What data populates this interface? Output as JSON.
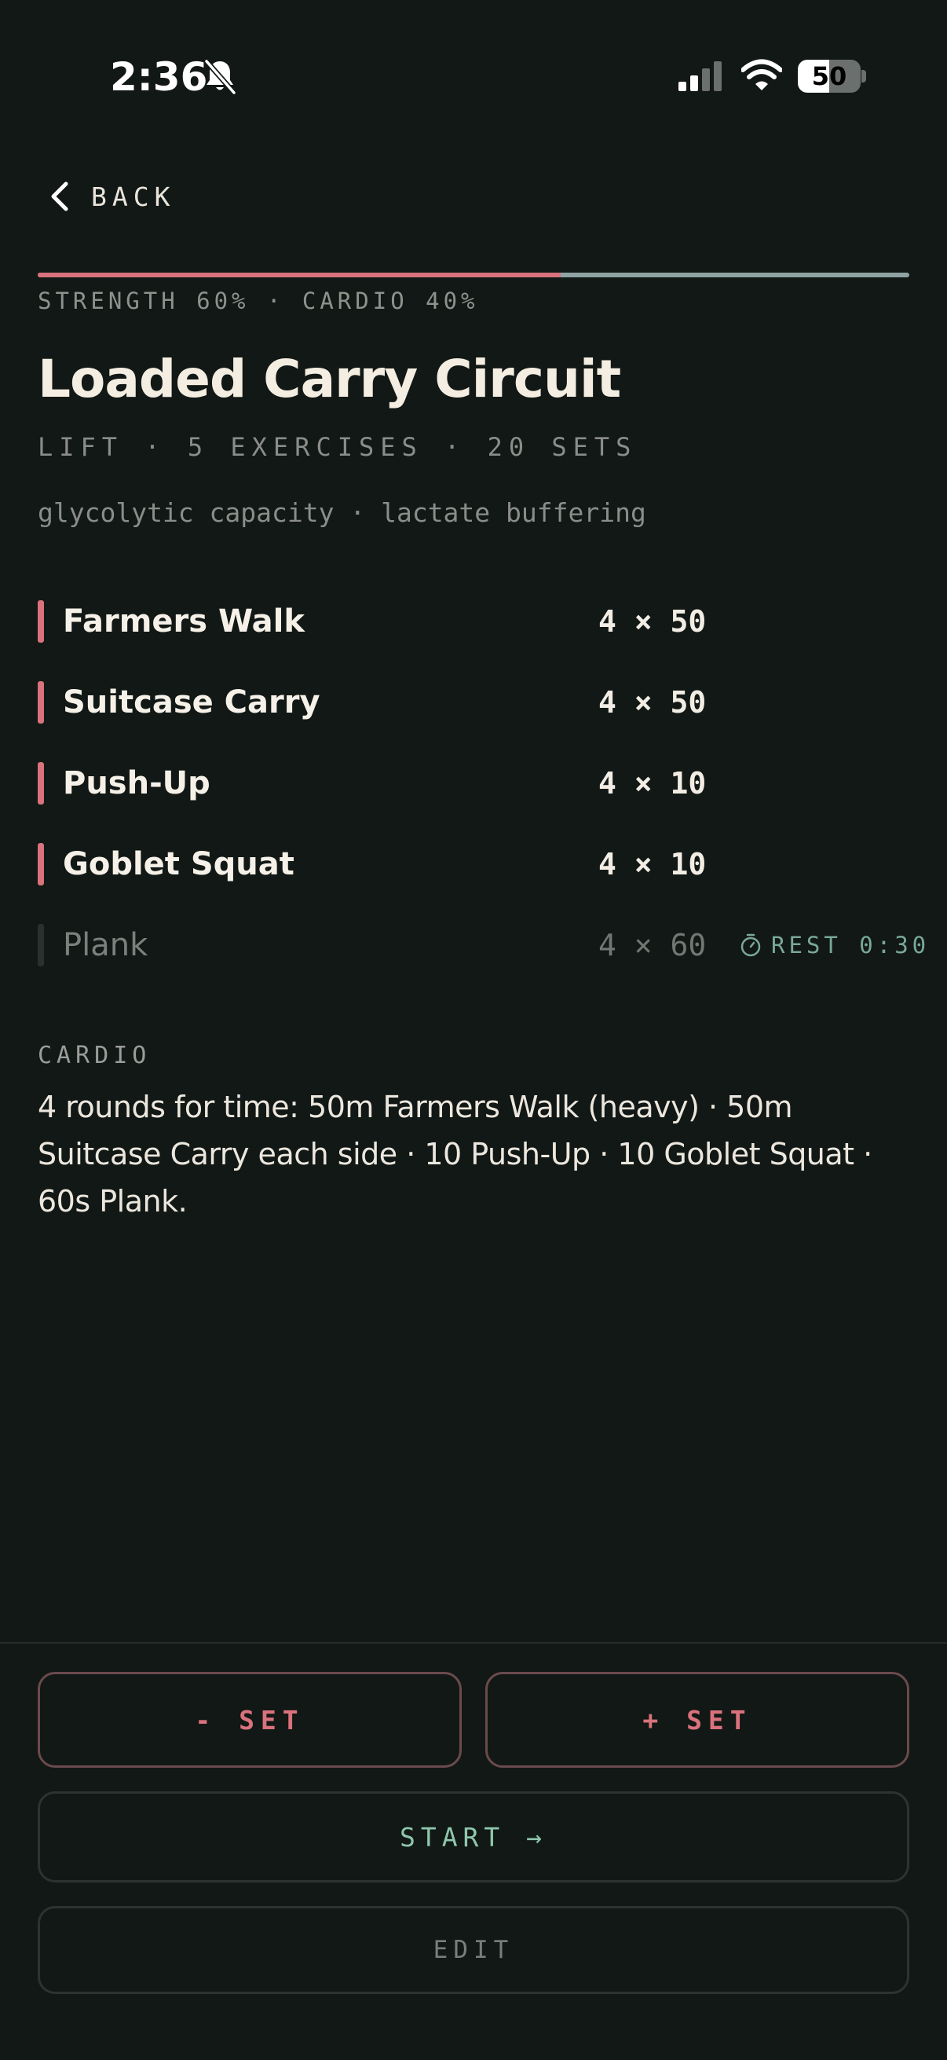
{
  "status_bar": {
    "time": "2:36",
    "battery": "50",
    "battery_level": 0.5,
    "icons": [
      "bell-slash-icon",
      "cellular-signal-icon",
      "wifi-icon",
      "battery-icon"
    ]
  },
  "nav": {
    "back_label": "BACK"
  },
  "split": {
    "label": "STRENGTH 60% · CARDIO 40%",
    "strength_fraction": 0.6,
    "cardio_fraction": 0.4,
    "strength_color": "#d9727c",
    "cardio_color": "#8fa3a3"
  },
  "workout": {
    "title": "Loaded Carry Circuit",
    "meta": "LIFT · 5 EXERCISES · 20 SETS",
    "tags": "glycolytic capacity · lactate buffering"
  },
  "exercises": [
    {
      "name": "Farmers Walk",
      "sets": "4 × 50"
    },
    {
      "name": "Suitcase Carry",
      "sets": "4 × 50"
    },
    {
      "name": "Push-Up",
      "sets": "4 × 10"
    },
    {
      "name": "Goblet Squat",
      "sets": "4 × 10"
    },
    {
      "name": "Plank",
      "sets": "4 × 60",
      "rest": "REST 0:30"
    }
  ],
  "cardio": {
    "heading": "CARDIO",
    "text": "4 rounds for time: 50m Farmers Walk (heavy) · 50m Suitcase Carry each side · 10 Push-Up · 10 Goblet Squat · 60s Plank."
  },
  "actions": {
    "minus_set": "- SET",
    "plus_set": "+ SET",
    "start": "START →",
    "edit": "EDIT"
  },
  "colors": {
    "background": "#121815",
    "accent_strength": "#d9727c",
    "accent_start": "#8fc7ae",
    "rest_accent": "#79a89b"
  }
}
